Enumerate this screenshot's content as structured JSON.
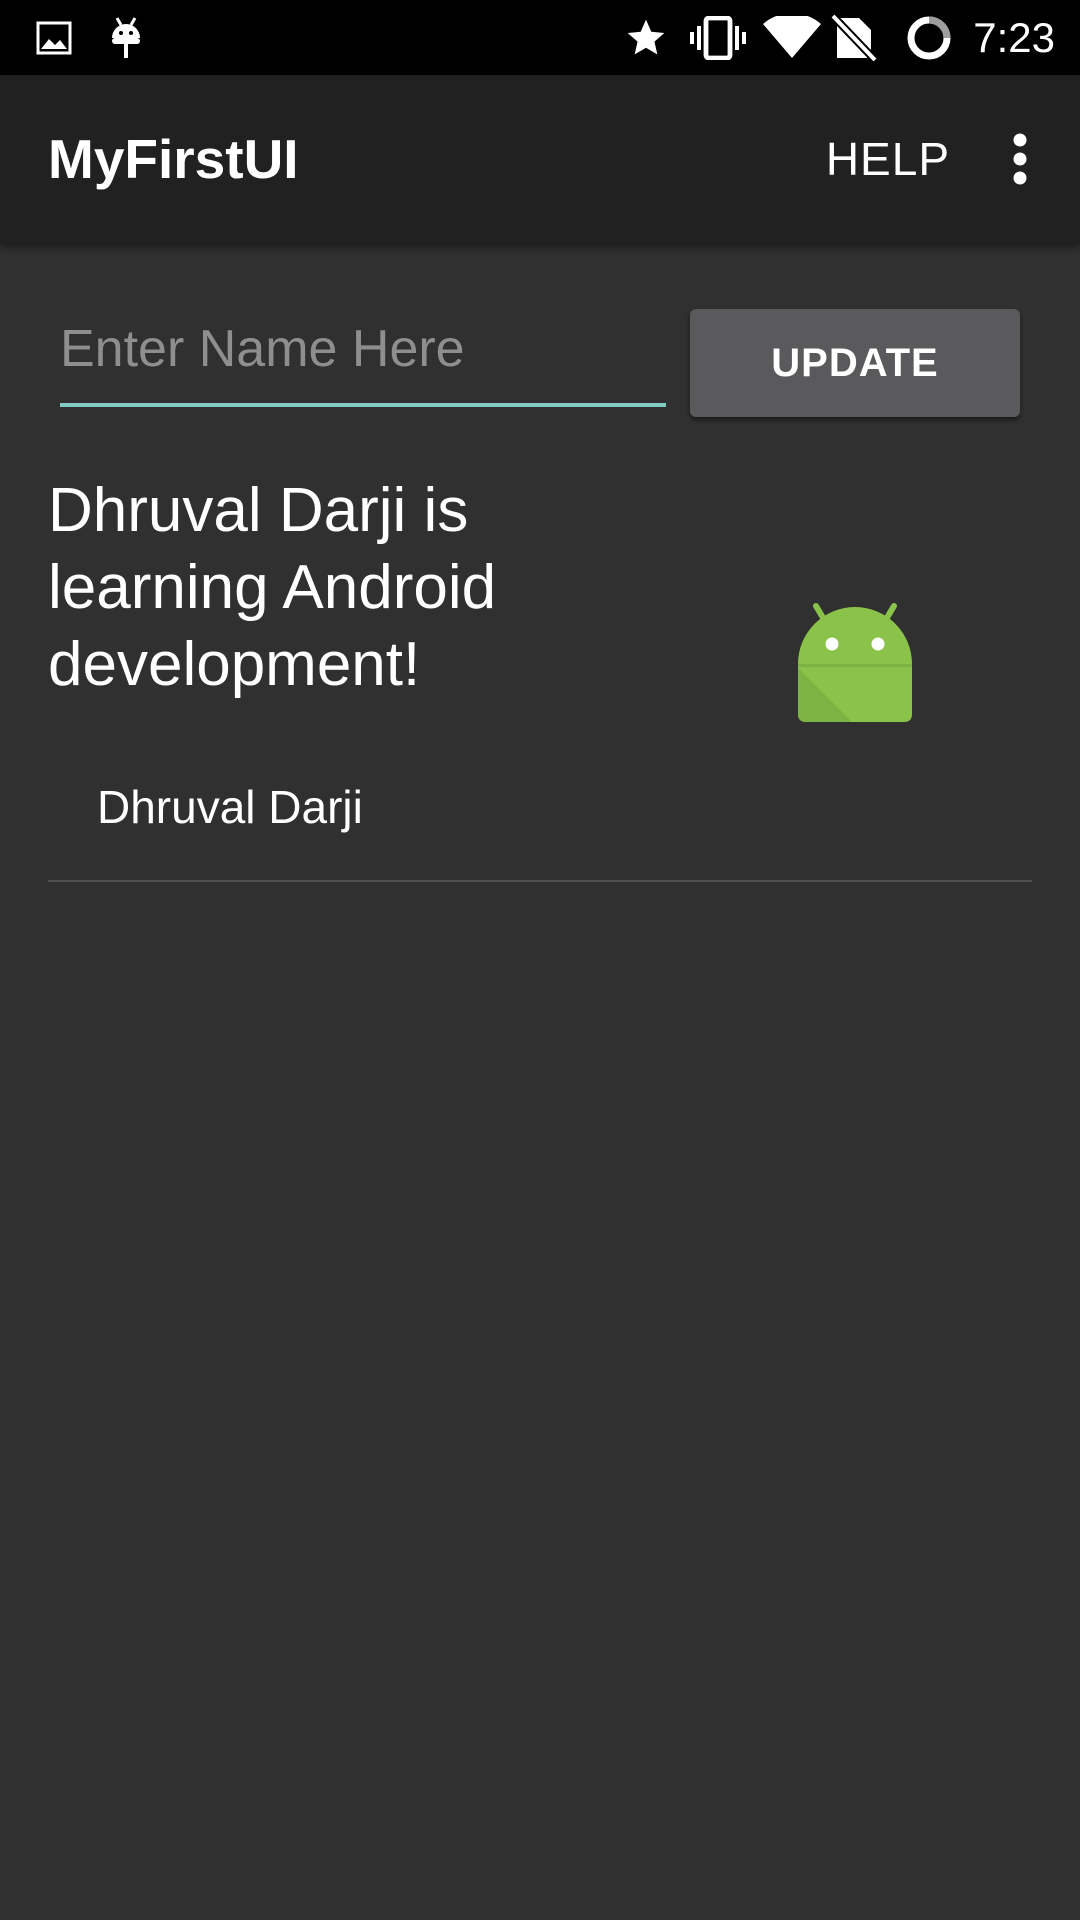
{
  "status_bar": {
    "time": "7:23",
    "left_icons": [
      "image-icon",
      "android-debug-icon"
    ],
    "right_icons": [
      "star-icon",
      "vibrate-icon",
      "wifi-icon",
      "no-sim-icon",
      "battery-ring-icon"
    ]
  },
  "app_bar": {
    "title": "MyFirstUI",
    "help_label": "HELP",
    "overflow_icon": "more-vert-icon"
  },
  "form": {
    "name_placeholder": "Enter Name Here",
    "name_value": "",
    "underline_color": "#80cbc4",
    "update_label": "UPDATE"
  },
  "content": {
    "message": "Dhruval Darji is learning Android development!",
    "name_label": "Dhruval Darji",
    "image_icon": "android-robot-icon",
    "android_color": "#8bc34a"
  }
}
